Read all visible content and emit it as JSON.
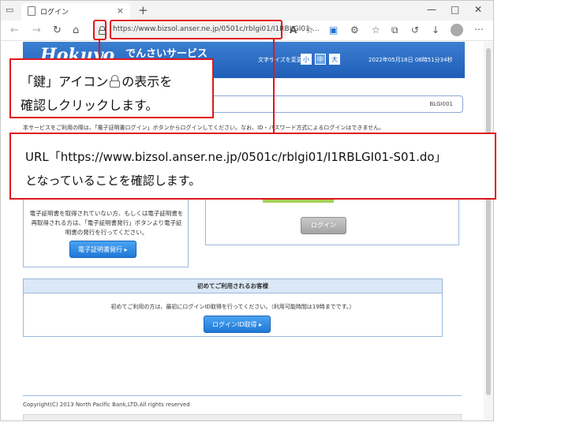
{
  "browser": {
    "tab_title": "ログイン",
    "tab_close": "×",
    "new_tab": "+",
    "window_minimize": "—",
    "window_maximize": "□",
    "window_close": "✕",
    "address_url": "https://www.bizsol.anser.ne.jp/0501c/rblgi01/I1RBLGI01-...",
    "nav_back": "←",
    "nav_forward": "→",
    "nav_reload": "↻",
    "nav_home": "⌂",
    "tool_read_aloud": "A",
    "tool_favorite": "☆",
    "tool_split": "▣",
    "tool_extensions": "⚙",
    "tool_favorites": "☆",
    "tool_collections": "⧉",
    "tool_history": "↺",
    "tool_downloads": "↓",
    "tool_more": "⋯"
  },
  "site": {
    "logo": "Hokuyo",
    "service_name": "でんさいサービス",
    "font_size_label": "文字サイズを変更",
    "font_sizes": [
      "小",
      "中",
      "大"
    ],
    "datetime": "2022年05月18日 08時51分34秒",
    "screen_id": "BLGI001",
    "notice": "本サービスをご利用の際は、「電子証明書ログイン」ボタンからログインしてください。なお、ID・パスワード方式によるログインはできません。"
  },
  "left_panel": {
    "text": "電子証明書を取得されていない方、もしくは電子証明書を再取得される方は、「電子証明書発行」ボタンより電子証明書の発行を行ってください。",
    "button": "電子証明書発行 ▸"
  },
  "right_panel": {
    "button": "ログイン"
  },
  "first_time": {
    "heading": "初めてご利用されるお客様",
    "description": "初めてご利用の方は、最初にログインID取得を行ってください。（利用可能時間は19時までです。）",
    "button": "ログインID取得 ▸"
  },
  "footer": {
    "copyright": "Copyright(C) 2013 North Pacific Bank,LTD.All rights reserved"
  },
  "callouts": {
    "lock_line1_before": "「鍵」アイコン",
    "lock_line1_after": "の表示を",
    "lock_line2": "確認しクリックします。",
    "url_line1": "URL「https://www.bizsol.anser.ne.jp/0501c/rblgi01/I1RBLGI01-S01.do」",
    "url_line2": "となっていることを確認します。"
  },
  "colors": {
    "callout_red": "#e0161c",
    "header_blue": "#1f5eb8",
    "button_blue": "#1f78d6"
  }
}
